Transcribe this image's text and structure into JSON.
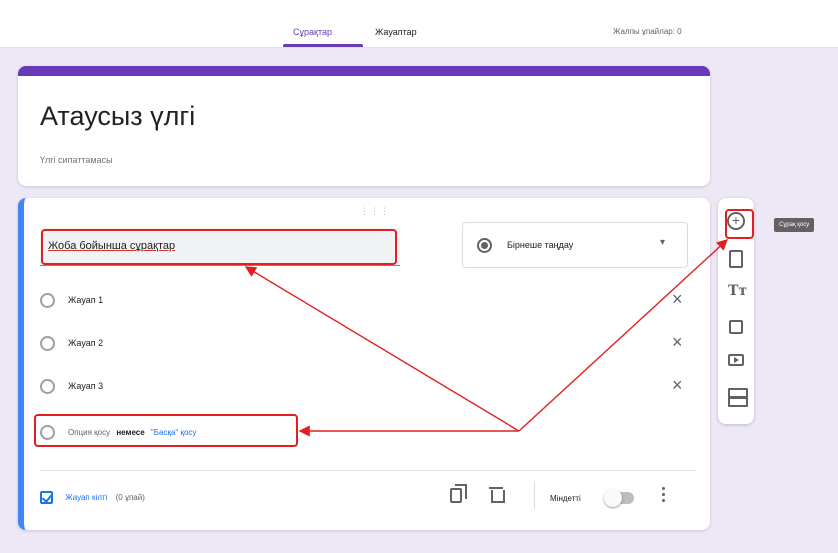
{
  "header": {
    "tabs": [
      {
        "label": "Сұрақтар",
        "active": true
      },
      {
        "label": "Жауаптар",
        "active": false
      }
    ],
    "total_score": "Жалпы ұпайлар: 0"
  },
  "title_card": {
    "title": "Атаусыз үлгі",
    "description": "Үлгі сипаттамасы"
  },
  "question": {
    "drag_handle": "⋮⋮⋮",
    "title": "Жоба бойынша сұрақтар",
    "type": "Бірнеше таңдау",
    "options": [
      "Жауап 1",
      "Жауап 2",
      "Жауап 3"
    ],
    "add_option": "Опция қосу",
    "or": "немесе",
    "add_other": "\"Басқа\" қосу",
    "answer_key": "Жауап кілті",
    "points": "(0 ұпай)",
    "required_label": "Міндетті"
  },
  "toolbar": {
    "items": [
      "add-question",
      "import-questions",
      "add-title",
      "add-image",
      "add-video",
      "add-section"
    ],
    "tooltip": "Сұрақ қосу"
  },
  "colors": {
    "accent": "#673ab7",
    "question_border": "#4285f4",
    "highlight": "#e02020",
    "link": "#1a73e8"
  }
}
